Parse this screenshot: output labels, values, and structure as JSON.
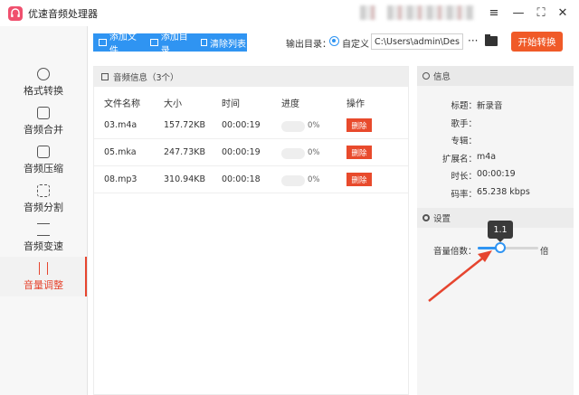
{
  "app": {
    "title": "优速音频处理器"
  },
  "sidebar": {
    "items": [
      {
        "label": "格式转换",
        "active": false
      },
      {
        "label": "音频合并",
        "active": false
      },
      {
        "label": "音频压缩",
        "active": false
      },
      {
        "label": "音频分割",
        "active": false
      },
      {
        "label": "音频变速",
        "active": false
      },
      {
        "label": "音量调整",
        "active": true
      }
    ]
  },
  "toolbar": {
    "add_file": "添加文件",
    "add_dir": "添加目录",
    "clear": "清除列表",
    "output_label": "输出目录：",
    "custom_label": "自定义",
    "output_path": "C:\\Users\\admin\\Deskto",
    "more": "···",
    "start": "开始转换"
  },
  "list": {
    "title": "音频信息（3个）",
    "headers": [
      "文件名称",
      "大小",
      "时间",
      "进度",
      "操作"
    ],
    "rows": [
      {
        "name": "03.m4a",
        "size": "157.72KB",
        "time": "00:00:19",
        "progress": "0%",
        "action": "删除"
      },
      {
        "name": "05.mka",
        "size": "247.73KB",
        "time": "00:00:19",
        "progress": "0%",
        "action": "删除"
      },
      {
        "name": "08.mp3",
        "size": "310.94KB",
        "time": "00:00:18",
        "progress": "0%",
        "action": "删除"
      }
    ]
  },
  "info": {
    "title": "信息",
    "fields": [
      {
        "key": "标题：",
        "value": "新录音"
      },
      {
        "key": "歌手：",
        "value": ""
      },
      {
        "key": "专辑：",
        "value": ""
      },
      {
        "key": "扩展名：",
        "value": "m4a"
      },
      {
        "key": "时长：",
        "value": "00:00:19"
      },
      {
        "key": "码率：",
        "value": "65.238 kbps"
      }
    ]
  },
  "settings": {
    "title": "设置",
    "volume_label": "音量倍数：",
    "volume_value": "1.1",
    "unit": "倍",
    "slider_fraction": 0.37
  },
  "colors": {
    "accent": "#2f94f2",
    "primary": "#f05a28",
    "danger": "#e84a2c",
    "active": "#e6452f"
  }
}
